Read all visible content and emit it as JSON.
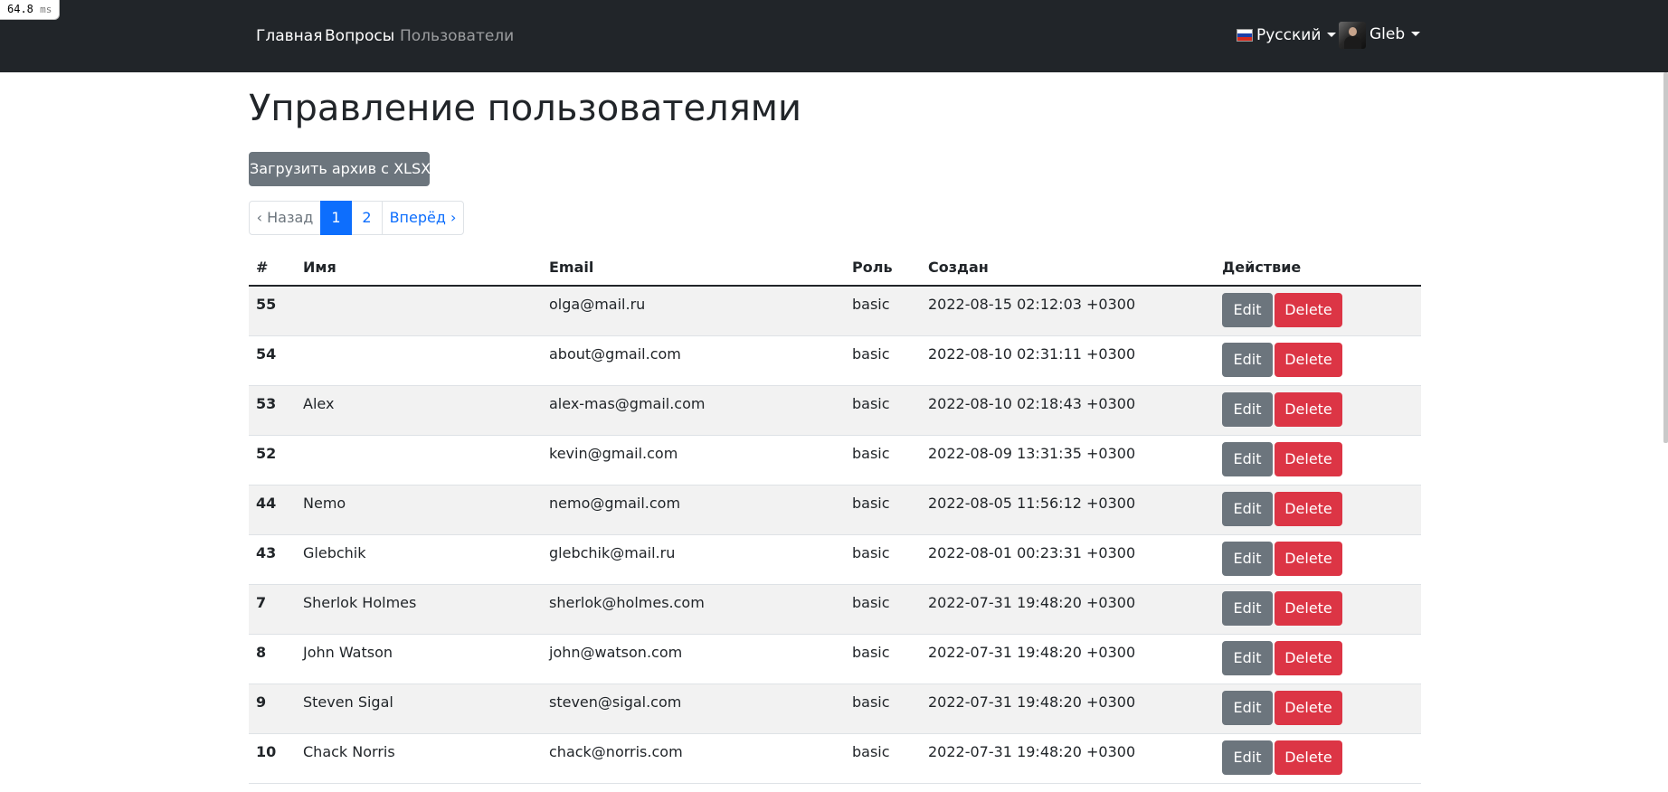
{
  "timer": {
    "value": "64.8",
    "unit": "ms"
  },
  "navbar": {
    "links": [
      {
        "label": "Главная"
      },
      {
        "label": "Вопросы"
      },
      {
        "label": "Пользователи",
        "active": true
      }
    ],
    "language": {
      "label": "Русский",
      "icon": "russia-flag-icon"
    },
    "user": {
      "name": "Gleb",
      "icon": "avatar"
    }
  },
  "page": {
    "title": "Управление пользователями"
  },
  "upload_button": {
    "label": "Загрузить архив с XLSX"
  },
  "pagination": {
    "prev": "‹ Назад",
    "pages": [
      "1",
      "2"
    ],
    "current": "1",
    "next": "Вперёд ›"
  },
  "table": {
    "headers": {
      "num": "#",
      "name": "Имя",
      "email": "Email",
      "role": "Роль",
      "created": "Создан",
      "action": "Действие"
    },
    "buttons": {
      "edit": "Edit",
      "delete": "Delete"
    },
    "rows": [
      {
        "id": "55",
        "name": "",
        "email": "olga@mail.ru",
        "role": "basic",
        "created": "2022-08-15 02:12:03 +0300"
      },
      {
        "id": "54",
        "name": "",
        "email": "about@gmail.com",
        "role": "basic",
        "created": "2022-08-10 02:31:11 +0300"
      },
      {
        "id": "53",
        "name": "Alex",
        "email": "alex-mas@gmail.com",
        "role": "basic",
        "created": "2022-08-10 02:18:43 +0300"
      },
      {
        "id": "52",
        "name": "",
        "email": "kevin@gmail.com",
        "role": "basic",
        "created": "2022-08-09 13:31:35 +0300"
      },
      {
        "id": "44",
        "name": "Nemo",
        "email": "nemo@gmail.com",
        "role": "basic",
        "created": "2022-08-05 11:56:12 +0300"
      },
      {
        "id": "43",
        "name": "Glebchik",
        "email": "glebchik@mail.ru",
        "role": "basic",
        "created": "2022-08-01 00:23:31 +0300"
      },
      {
        "id": "7",
        "name": "Sherlok Holmes",
        "email": "sherlok@holmes.com",
        "role": "basic",
        "created": "2022-07-31 19:48:20 +0300"
      },
      {
        "id": "8",
        "name": "John Watson",
        "email": "john@watson.com",
        "role": "basic",
        "created": "2022-07-31 19:48:20 +0300"
      },
      {
        "id": "9",
        "name": "Steven Sigal",
        "email": "steven@sigal.com",
        "role": "basic",
        "created": "2022-07-31 19:48:20 +0300"
      },
      {
        "id": "10",
        "name": "Chack Norris",
        "email": "chack@norris.com",
        "role": "basic",
        "created": "2022-07-31 19:48:20 +0300"
      }
    ]
  },
  "colors": {
    "navbar": "#212529",
    "primary": "#0d6efd",
    "secondary": "#6c757d",
    "danger": "#dc3545",
    "stripe": "#f2f2f2"
  }
}
